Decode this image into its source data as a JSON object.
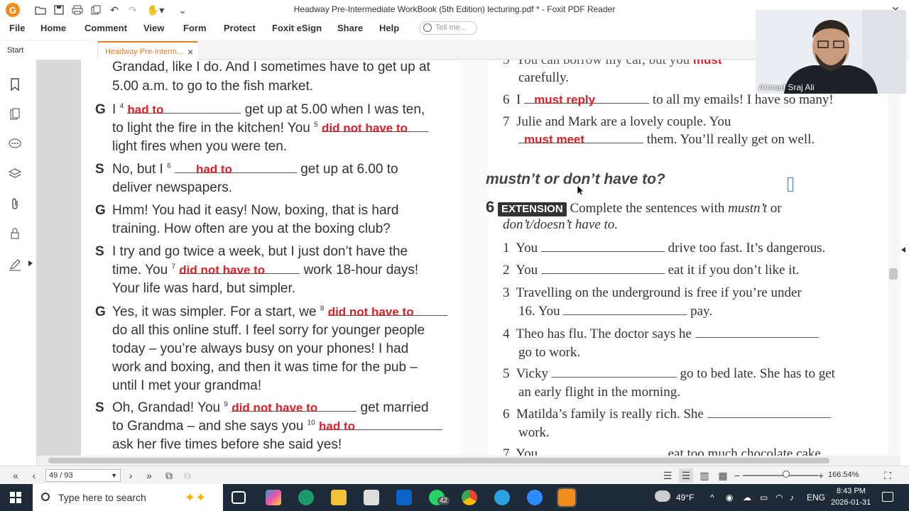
{
  "window": {
    "title": "Headway Pre-Intermediate WorkBook (5th Edition) lecturing.pdf * - Foxit PDF Reader",
    "logo_letter": "G"
  },
  "menu": [
    "File",
    "Home",
    "Comment",
    "View",
    "Form",
    "Protect",
    "Foxit eSign",
    "Share",
    "Help"
  ],
  "tell_me": {
    "placeholder": "Tell me..."
  },
  "tabs": {
    "start": "Start",
    "document": "Headway Pre-Interm..."
  },
  "left_column": {
    "lines": [
      {
        "speaker": "",
        "text": "Grandad, like I do. And I sometimes have to get up at"
      },
      {
        "speaker": "",
        "text": "5.00 a.m. to go to the fish market."
      }
    ],
    "g1": {
      "speaker": "G",
      "pre": "I",
      "sup1": "4",
      "ans1": "had to",
      "mid1": "get up at 5.00 when I was ten,",
      "line2_pre": "to light the fire in the kitchen! You",
      "sup2": "5",
      "ans2": "did not have to",
      "line3": "light fires when you were ten."
    },
    "s1": {
      "speaker": "S",
      "pre": "No, but I",
      "sup": "6",
      "ans": "had to",
      "post": "get up at 6.00 to",
      "line2": "deliver newspapers."
    },
    "g2": {
      "speaker": "G",
      "line1": "Hmm! You had it easy! Now, boxing, that is hard",
      "line2": "training. How often are you at the boxing club?"
    },
    "s2": {
      "speaker": "S",
      "line1": "I try and go twice a week, but I just don’t have the",
      "line2_pre": "time. You",
      "sup": "7",
      "ans": "did not have to",
      "line2_post": "work 18-hour days!",
      "line3": "Your life was hard, but simpler."
    },
    "g3": {
      "speaker": "G",
      "line1_pre": "Yes, it was simpler. For a start, we",
      "sup": "8",
      "ans": "did not have to",
      "line2": "do all this online stuff. I feel sorry for younger people",
      "line3": "today – you’re always busy on your phones! I had",
      "line4": "work and boxing, and then it was time for the pub –",
      "line5": "until I met your grandma!"
    },
    "s3": {
      "speaker": "S",
      "line1_pre": "Oh, Grandad! You",
      "sup1": "9",
      "ans1": "did not have to",
      "line1_post": "get married",
      "line2_pre": "to Grandma – and she says you",
      "sup2": "10",
      "ans2": "had to",
      "line3": "ask her five times before she said yes!"
    }
  },
  "right_column": {
    "top_cut": {
      "num": "5",
      "text": "You can borrow my car, but you",
      "ans": "must",
      "line2": "carefully."
    },
    "item6": {
      "num": "6",
      "pre": "I",
      "ans": "must reply",
      "post": "to all my emails! I have so many!"
    },
    "item7": {
      "num": "7",
      "line1": "Julie and Mark are a lovely couple. You",
      "ans": "must meet",
      "post": "them. You’ll really get on well."
    },
    "section_heading": "mustn’t or don’t have to?",
    "exercise": {
      "num": "6",
      "badge": "EXTENSION",
      "instruction_pre": "Complete the sentences with",
      "instruction_italic1": "mustn’t",
      "instruction_or": "or",
      "instruction_italic2": "don’t/doesn’t have to."
    },
    "items": [
      {
        "num": "1",
        "pre": "You",
        "post": "drive too fast. It’s dangerous."
      },
      {
        "num": "2",
        "pre": "You",
        "post": "eat it if you don’t like it."
      },
      {
        "num": "3",
        "line1": "Travelling on the underground is free if you’re under",
        "pre": "16. You",
        "post": "pay."
      },
      {
        "num": "4",
        "pre": "Theo has flu. The doctor says he",
        "line2": "go to work."
      },
      {
        "num": "5",
        "pre": "Vicky",
        "post": "go to bed late. She has to get",
        "line2": "an early flight in the morning."
      },
      {
        "num": "6",
        "pre": "Matilda’s family is really rich. She",
        "line2": "work."
      },
      {
        "num": "7",
        "pre": "You",
        "post": "eat too much chocolate cake"
      }
    ]
  },
  "navigation": {
    "page_indicator": "49 / 93",
    "zoom": "166.54%"
  },
  "webcam": {
    "name": "Ahmad Sraj Ali"
  },
  "taskbar": {
    "search_placeholder": "Type here to search",
    "whatsapp_badge": "42",
    "weather": "49°F",
    "language": "ENG",
    "time": "8:43 PM",
    "date": "2026-01-31"
  },
  "colors": {
    "answer_red": "#d8232a",
    "accent_orange": "#e87d1e",
    "taskbar": "#1f2a38"
  }
}
